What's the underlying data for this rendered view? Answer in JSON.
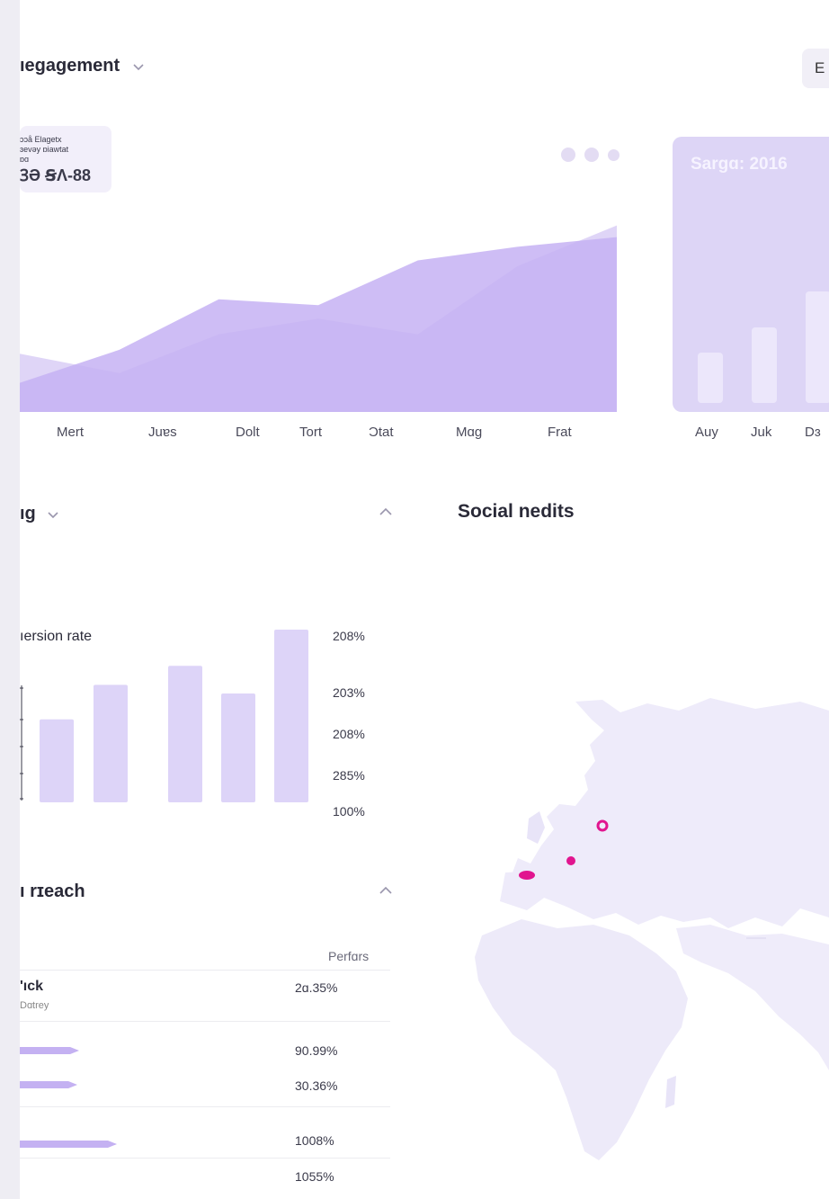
{
  "header": {
    "title": "ıegagement",
    "export_label": "E"
  },
  "tooltip": {
    "line1": "ɔɔå Elagetx",
    "line2": "ɜevǝy ɒiawtat",
    "line3": "ɒɑ",
    "value": "ꝪƏ ꞨɅ-88"
  },
  "main_chart": {
    "x_labels": [
      "Mert",
      "Juɐs",
      "Dolt",
      "Tort",
      "Ɔtat",
      "Mɑg",
      "Frat"
    ]
  },
  "side_card": {
    "title": "Sargɑ: 2016",
    "x_labels": [
      "Auy",
      "Juk",
      "Dɜ"
    ]
  },
  "funnel": {
    "title": "ıg"
  },
  "conversion": {
    "label": "ıersion rate",
    "y_ticks": [
      "208%",
      "203%",
      "208%",
      "285%",
      "100%"
    ]
  },
  "reach": {
    "title": "ı rɪeach",
    "column_header": "Perfɑrs",
    "row_name": "'ıck",
    "row_sub": "Dɑtrey",
    "values": [
      "2ɑ.35%",
      "90.99%",
      "30.36%",
      "1008%",
      "1055%"
    ]
  },
  "social": {
    "title": "Social nedits"
  },
  "colors": {
    "accent": "#c5b1f3",
    "accent_light": "#ddd3f7",
    "bar": "#ddd4f8",
    "marker": "#e1158f",
    "map_land": "#efecfa"
  },
  "chart_data": [
    {
      "type": "area",
      "categories": [
        "Mert",
        "Juɐs",
        "Dolt",
        "Tort",
        "Ɔtat",
        "Mɑg",
        "Frat"
      ],
      "series": [
        {
          "values": [
            30,
            20,
            40,
            48,
            40,
            75,
            96
          ]
        },
        {
          "values": [
            15,
            32,
            58,
            55,
            78,
            85,
            90
          ]
        }
      ],
      "ylim": [
        0,
        100
      ]
    },
    {
      "type": "bar",
      "categories": [
        "Auy",
        "Juk",
        "Dɜ"
      ],
      "values": [
        28,
        42,
        62
      ],
      "ylim": [
        0,
        100
      ]
    },
    {
      "type": "bar",
      "values": [
        48,
        68,
        79,
        63,
        100
      ],
      "ylim": [
        0,
        100
      ]
    }
  ]
}
